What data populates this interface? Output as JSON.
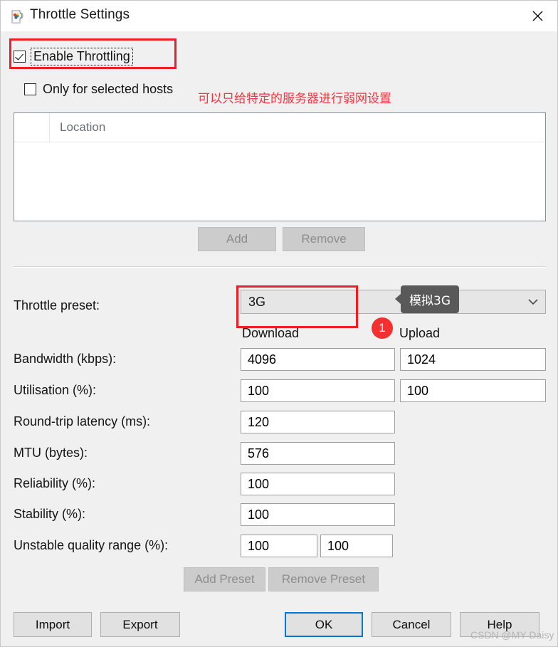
{
  "window": {
    "title": "Throttle Settings",
    "icon": "charles-jug-icon",
    "close_icon": "close-icon"
  },
  "options": {
    "enable_throttling": {
      "label": "Enable Throttling",
      "checked": true,
      "focused": true
    },
    "only_selected_hosts": {
      "label": "Only for selected hosts",
      "checked": false
    }
  },
  "annotations": {
    "note_hosts": "可以只给特定的服务器进行弱网设置",
    "badge_number": "1",
    "tooltip_preset": "模拟3G"
  },
  "hosts_table": {
    "columns": [
      "",
      "Location"
    ],
    "rows": []
  },
  "host_buttons": {
    "add": "Add",
    "remove": "Remove"
  },
  "preset": {
    "label": "Throttle preset:",
    "value": "3G",
    "arrow_icon": "chevron-down-icon"
  },
  "columns": {
    "download": "Download",
    "upload": "Upload"
  },
  "fields": [
    {
      "label": "Bandwidth (kbps):",
      "download": "4096",
      "upload": "1024"
    },
    {
      "label": "Utilisation (%):",
      "download": "100",
      "upload": "100"
    },
    {
      "label": "Round-trip latency (ms):",
      "download": "120",
      "upload": null
    },
    {
      "label": "MTU (bytes):",
      "download": "576",
      "upload": null
    },
    {
      "label": "Reliability (%):",
      "download": "100",
      "upload": null
    },
    {
      "label": "Stability (%):",
      "download": "100",
      "upload": null
    },
    {
      "label": "Unstable quality range (%):",
      "download": "100",
      "upload": "100"
    }
  ],
  "preset_buttons": {
    "add_preset": "Add Preset",
    "remove_preset": "Remove Preset"
  },
  "dialog_buttons": {
    "import": "Import",
    "export": "Export",
    "ok": "OK",
    "cancel": "Cancel",
    "help": "Help"
  },
  "watermark": "CSDN @MY Daisy",
  "colors": {
    "annotation_red": "#ec2024",
    "badge_red": "#f23030",
    "tooltip_bg": "#595959",
    "default_button_border": "#0078d7",
    "window_bg": "#f0f0f0"
  }
}
